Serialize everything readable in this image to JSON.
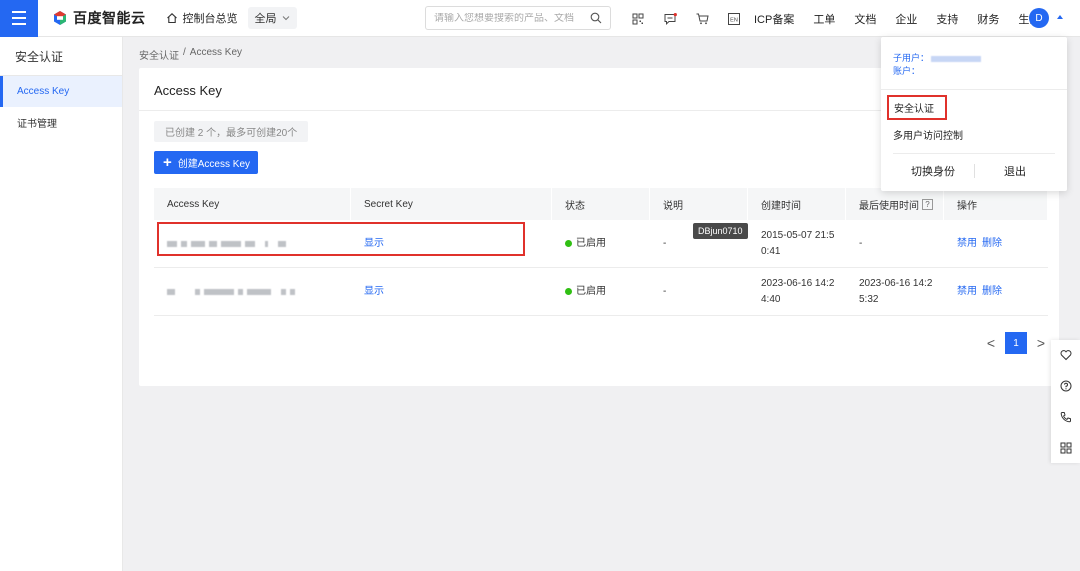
{
  "header": {
    "logo_text": "百度智能云",
    "console_label": "控制台总览",
    "region_label": "全局",
    "search_placeholder": "请输入您想要搜索的产品、文档",
    "icons": [
      "qrcode-icon",
      "message-icon",
      "cart-icon",
      "language-icon"
    ],
    "language_label": "EN",
    "nav": [
      "ICP备案",
      "工单",
      "文档",
      "企业",
      "支持",
      "财务",
      "生态"
    ],
    "avatar_letter": "D"
  },
  "sidebar": {
    "title": "安全认证",
    "items": [
      {
        "label": "Access Key",
        "active": true
      },
      {
        "label": "证书管理",
        "active": false
      }
    ]
  },
  "breadcrumb": {
    "parent": "安全认证",
    "separator": "/",
    "current": "Access Key"
  },
  "main": {
    "title": "Access Key",
    "quota_text": "已创建 2 个，最多可创建20个",
    "create_button": "创建Access Key",
    "table": {
      "headers": [
        "Access Key",
        "Secret Key",
        "状态",
        "说明",
        "创建时间",
        "最后使用时间",
        "操作"
      ],
      "help_mark": "?",
      "rows": [
        {
          "secret_key_action": "显示",
          "status": "已启用",
          "description": "-",
          "created_line1": "2015-05-07 21:5",
          "created_line2": "0:41",
          "last_used_line1": "-",
          "last_used_line2": "",
          "op_disable": "禁用",
          "op_delete": "删除"
        },
        {
          "secret_key_action": "显示",
          "status": "已启用",
          "description": "-",
          "created_line1": "2023-06-16 14:2",
          "created_line2": "4:40",
          "last_used_line1": "2023-06-16 14:2",
          "last_used_line2": "5:32",
          "op_disable": "禁用",
          "op_delete": "删除"
        }
      ]
    },
    "tooltip": "DBjun0710",
    "pagination": {
      "prev": "<",
      "current_page": "1",
      "next": ">"
    }
  },
  "user_dropdown": {
    "subuser_label": "子用户：",
    "account_label": "账户：",
    "security": "安全认证",
    "multi_user_access": "多用户访问控制",
    "switch_identity": "切换身份",
    "logout": "退出"
  },
  "float_toolbar": {
    "icons": [
      "heart-icon",
      "help-icon",
      "phone-icon",
      "apps-icon"
    ]
  },
  "colors": {
    "brand_blue": "#2468f2",
    "status_green": "#30bf13",
    "highlight_red": "#e0312b"
  }
}
